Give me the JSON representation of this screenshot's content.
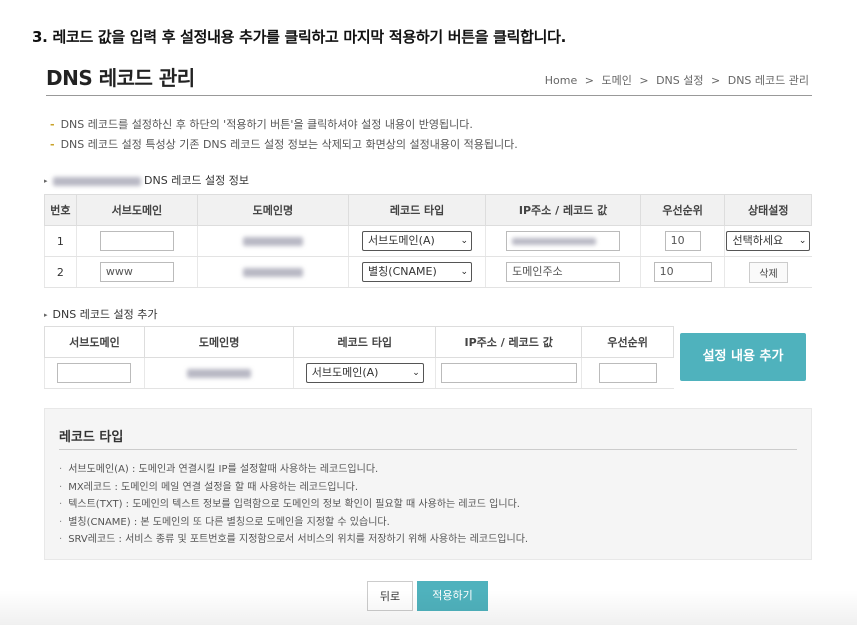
{
  "step_instruction": "3. 레코드 값을 입력 후 설정내용 추가를 클릭하고 마지막 적용하기 버튼을 클릭합니다.",
  "page_title": "DNS 레코드 관리",
  "breadcrumb": [
    "Home",
    "도메인",
    "DNS 설정",
    "DNS 레코드 관리"
  ],
  "breadcrumb_sep": ">",
  "notes": [
    "DNS 레코드를 설정하신 후 하단의 '적용하기 버튼'을 클릭하셔야 설정 내용이 반영됩니다.",
    "DNS 레코드 설정 특성상 기존 DNS 레코드 설정 정보는 삭제되고 화면상의 설정내용이 적용됩니다."
  ],
  "note_dash": "-",
  "info_section": {
    "title": "DNS 레코드 설정 정보"
  },
  "info_table": {
    "headers": [
      "번호",
      "서브도메인",
      "도메인명",
      "레코드 타입",
      "IP주소 / 레코드 값",
      "우선순위",
      "상태설정"
    ],
    "rows": [
      {
        "no": "1",
        "subdomain": "",
        "record_type": "서브도메인(A)",
        "ip_value": "",
        "priority": "10",
        "status": "선택하세요"
      },
      {
        "no": "2",
        "subdomain": "www",
        "record_type": "별칭(CNAME)",
        "ip_value": "도메인주소",
        "priority": "10",
        "status": "삭제"
      }
    ]
  },
  "add_section": {
    "title": "DNS 레코드 설정 추가"
  },
  "add_table": {
    "headers": [
      "서브도메인",
      "도메인명",
      "레코드 타입",
      "IP주소 / 레코드 값",
      "우선순위"
    ],
    "record_type": "서브도메인(A)",
    "add_button": "설정 내용 추가"
  },
  "record_types_box": {
    "title": "레코드 타입",
    "items": [
      "서브도메인(A) : 도메인과 연결시킬 IP를 설정할때 사용하는 레코드입니다.",
      "MX레코드 : 도메인의 메일 연결 설정을 할 때 사용하는 레코드입니다.",
      "텍스트(TXT) : 도메인의 텍스트 정보를 입력함으로 도메인의 정보 확인이 필요할 때 사용하는 레코드 입니다.",
      "별칭(CNAME) : 본 도메인의 또 다른 별칭으로 도메인을 지정할 수 있습니다.",
      "SRV레코드 : 서비스 종류 및 포트번호를 지정함으로서 서비스의 위치를 저장하기 위해 사용하는 레코드입니다."
    ]
  },
  "buttons": {
    "back": "뒤로",
    "apply": "적용하기"
  },
  "colors": {
    "accent": "#4fb2bd",
    "note_dash": "#c9a32a"
  },
  "icons": {
    "triangle": "▸",
    "chevron": "⌄"
  }
}
